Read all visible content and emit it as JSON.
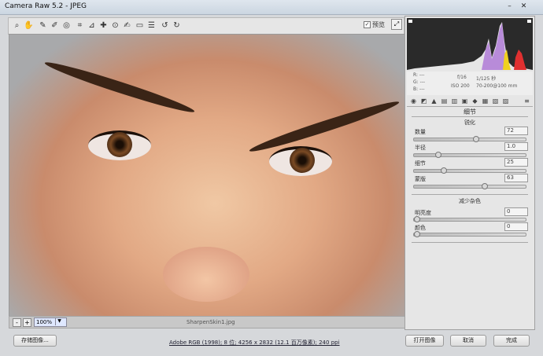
{
  "window": {
    "title": "Camera Raw 5.2  -  JPEG"
  },
  "toolbar": {
    "tools": [
      "zoom-icon",
      "hand-icon",
      "white-balance-icon",
      "color-sampler-icon",
      "target-adjust-icon",
      "crop-icon",
      "straighten-icon",
      "spot-removal-icon",
      "red-eye-icon",
      "adjustment-brush-icon",
      "gradient-icon",
      "preferences-icon",
      "rotate-ccw-icon",
      "rotate-cw-icon"
    ],
    "preview_label": "预览",
    "preview_checked": "✓"
  },
  "status": {
    "zoom": "100%",
    "filename": "SharpenSkin1.jpg"
  },
  "exif": {
    "r": "R:   ---",
    "g": "G:   ---",
    "b": "B:   ---",
    "aperture": "f/16",
    "shutter": "1/125 秒",
    "iso": "ISO 200",
    "lens": "70-200@100 mm"
  },
  "panel": {
    "title": "细节",
    "sharpen_title": "锐化",
    "sharpen": [
      {
        "label": "数量",
        "value": "72",
        "level": 0.55
      },
      {
        "label": "半径",
        "value": "1.0",
        "level": 0.2
      },
      {
        "label": "细节",
        "value": "25",
        "level": 0.25
      },
      {
        "label": "蒙版",
        "value": "63",
        "level": 0.63
      }
    ],
    "nr_title": "减少杂色",
    "noise": [
      {
        "label": "明亮度",
        "value": "0",
        "level": 0
      },
      {
        "label": "颜色",
        "value": "0",
        "level": 0
      }
    ]
  },
  "buttons": {
    "save": "存储图像...",
    "open": "打开图像",
    "cancel": "取消",
    "done": "完成"
  },
  "info_link": "Adobe RGB (1998); 8 位; 4256 x 2832 (12.1 百万像素); 240 ppi"
}
